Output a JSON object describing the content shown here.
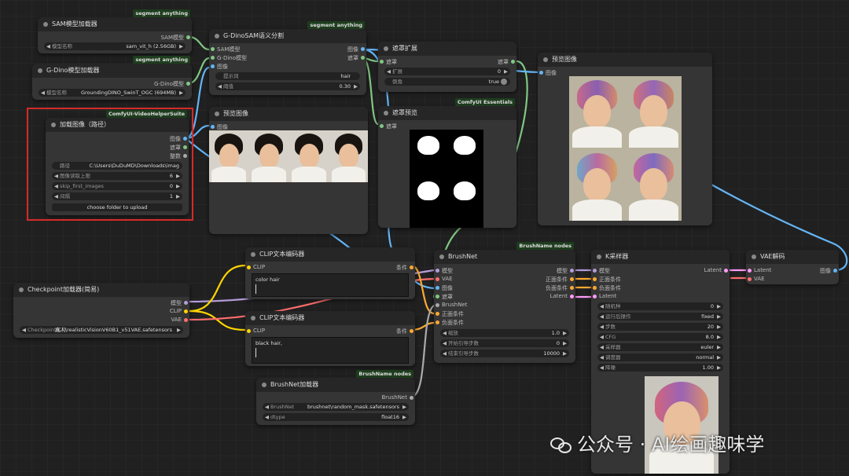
{
  "colors": {
    "model": "#b39ddb",
    "clip": "#ffd500",
    "vae": "#ff6e6e",
    "image": "#64b5f6",
    "mask": "#81c784",
    "cond": "#ffa931",
    "latent": "#ff9cf9",
    "other": "#aaaaaa"
  },
  "sam_loader": {
    "title": "SAM模型加载器",
    "badge": "segment anything",
    "output": "SAM模型",
    "model_label": "模型名称",
    "model_value": "sam_vit_h (2.56GB)"
  },
  "gdino_loader": {
    "title": "G-Dino模型加载器",
    "badge": "segment anything",
    "output": "G-Dino模型",
    "model_label": "模型名称",
    "model_value": "GroundingDINO_SwinT_OGC (694MB)"
  },
  "gdino_sam": {
    "title": "G-DinoSAM语义分割",
    "badge": "segment anything",
    "inputs": [
      "SAM模型",
      "G-Dino模型",
      "图像"
    ],
    "outputs": [
      "图像",
      "遮罩"
    ],
    "prompt_label": "提示词",
    "prompt_value": "hair",
    "threshold_label": "阈值",
    "threshold_value": "0.30"
  },
  "load_images": {
    "title": "加载图像（路径）",
    "badge": "ComfyUI-VideoHelperSuite",
    "outputs": [
      "图像",
      "遮罩",
      "整数"
    ],
    "path_label": "路径",
    "path_value": "C:\\Users\\DuDuMD\\Downloads\\imag",
    "cap_label": "图像读取上限",
    "cap_value": "6",
    "skip_label": "skip_first_images",
    "skip_value": "0",
    "select_label": "间隔",
    "select_value": "1",
    "upload_button": "choose folder to upload"
  },
  "preview1": {
    "title": "预览图像",
    "input": "图像"
  },
  "mask_grow": {
    "title": "遮罩扩展",
    "input": "遮罩",
    "output": "遮罩",
    "expand_label": "扩展",
    "expand_value": "0",
    "taper_label": "倒角",
    "taper_value": "true"
  },
  "mask_preview": {
    "title": "遮罩预览",
    "badge": "ComfyUI Essentials",
    "input": "遮罩"
  },
  "preview2": {
    "title": "预览图像",
    "input": "图像"
  },
  "checkpoint": {
    "title": "Checkpoint加载器(简易)",
    "outputs": [
      "模型",
      "CLIP",
      "VAE"
    ],
    "ckpt_label": "Checkpoint名称",
    "ckpt_value": "真人\\realisticVisionV60B1_v51VAE.safetensors"
  },
  "clip_pos": {
    "title": "CLIP文本编码器",
    "input": "CLIP",
    "output": "条件",
    "text": "color hair"
  },
  "clip_neg": {
    "title": "CLIP文本编码器",
    "input": "CLIP",
    "output": "条件",
    "text": "black hair,"
  },
  "brushnet_loader": {
    "title": "BrushNet加载器",
    "badge": "BrushName nodes",
    "output": "BrushNet",
    "brushnet_label": "BrushNet",
    "brushnet_value": "brushnet\\random_mask.safetensors",
    "dtype_label": "dtype",
    "dtype_value": "float16"
  },
  "brushnet": {
    "title": "BrushNet",
    "badge": "BrushName nodes",
    "inputs": [
      "模型",
      "VAE",
      "图像",
      "遮罩",
      "BrushNet",
      "正面条件",
      "负面条件"
    ],
    "outputs": [
      "模型",
      "正面条件",
      "负面条件",
      "Latent"
    ],
    "scale_label": "缩放",
    "scale_value": "1.0",
    "start_label": "开始引导步数",
    "start_value": "0",
    "end_label": "结束引导步数",
    "end_value": "10000"
  },
  "ksampler": {
    "title": "K采样器",
    "inputs": [
      "模型",
      "正面条件",
      "负面条件",
      "Latent"
    ],
    "output": "Latent",
    "seed_label": "随机种",
    "seed_value": "0",
    "after_label": "运行后操作",
    "after_value": "fixed",
    "steps_label": "步数",
    "steps_value": "20",
    "cfg_label": "CFG",
    "cfg_value": "8.0",
    "sampler_label": "采样器",
    "sampler_value": "euler",
    "scheduler_label": "调度器",
    "scheduler_value": "normal",
    "denoise_label": "降噪",
    "denoise_value": "1.00"
  },
  "vae_decode": {
    "title": "VAE解码",
    "inputs": [
      "Latent",
      "VAE"
    ],
    "output": "图像"
  },
  "watermark": {
    "text": "公众号 · AI绘画趣味学"
  }
}
